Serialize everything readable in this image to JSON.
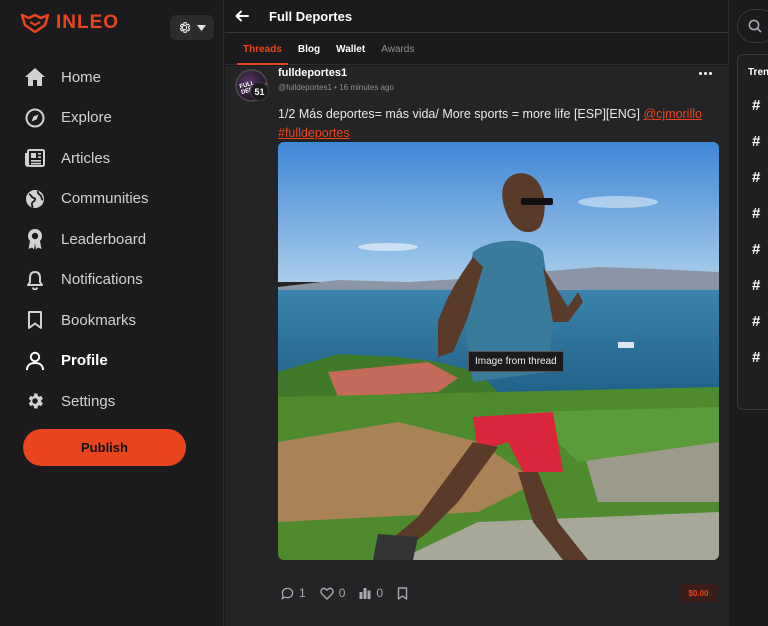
{
  "app": {
    "logo_text": "INLEO",
    "brand_color": "#e8451e"
  },
  "sidebar": {
    "items": [
      {
        "label": "Home",
        "icon": "home-icon"
      },
      {
        "label": "Explore",
        "icon": "compass-icon"
      },
      {
        "label": "Articles",
        "icon": "newspaper-icon"
      },
      {
        "label": "Communities",
        "icon": "globe-icon"
      },
      {
        "label": "Leaderboard",
        "icon": "award-icon"
      },
      {
        "label": "Notifications",
        "icon": "bell-icon"
      },
      {
        "label": "Bookmarks",
        "icon": "bookmark-icon"
      },
      {
        "label": "Profile",
        "icon": "user-icon",
        "active": true
      },
      {
        "label": "Settings",
        "icon": "gear-icon"
      }
    ],
    "publish_label": "Publish"
  },
  "header": {
    "title": "Full Deportes"
  },
  "tabs": [
    {
      "label": "Threads",
      "active": true
    },
    {
      "label": "Blog"
    },
    {
      "label": "Wallet"
    },
    {
      "label": "Awards",
      "muted": true
    }
  ],
  "post": {
    "author": "fulldeportes1",
    "handle": "@fulldeportes1",
    "time": "16 minutes ago",
    "reputation": "51",
    "avatar_text": "FULL DEPORTES",
    "text": "1/2 Más deportes= más vida/ More sports = more life [ESP][ENG] ",
    "mention": "@cjmorillo",
    "hashtag": "#fulldeportes",
    "image_tooltip": "Image from thread",
    "comments": "1",
    "likes": "0",
    "votes": "0",
    "payout": "$0.00"
  },
  "right": {
    "trending_title": "Trending"
  }
}
